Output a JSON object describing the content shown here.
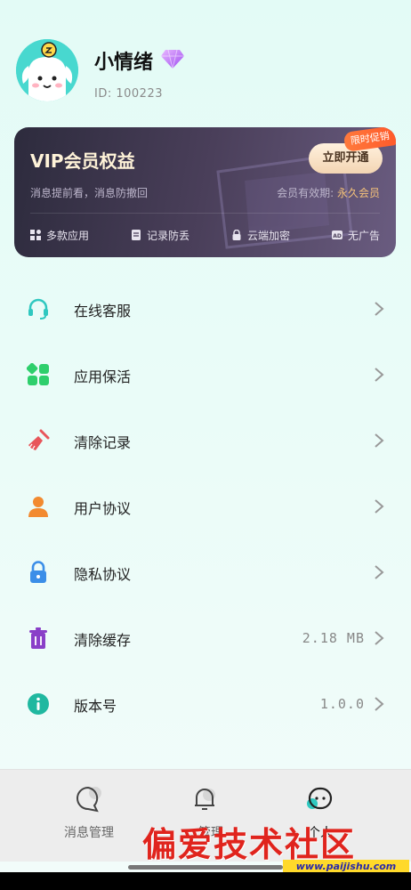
{
  "profile": {
    "username": "小情绪",
    "id_text": "ID: 100223"
  },
  "vip": {
    "title": "VIP会员权益",
    "subtitle": "消息提前看，消息防撤回",
    "expiry_label": "会员有效期:",
    "expiry_value": "永久会员",
    "button_label": "立即开通",
    "promo_tag": "限时促销",
    "features": [
      {
        "label": "多款应用",
        "icon": "apps-icon"
      },
      {
        "label": "记录防丢",
        "icon": "record-icon"
      },
      {
        "label": "云端加密",
        "icon": "lock-icon"
      },
      {
        "label": "无广告",
        "icon": "ad-icon"
      }
    ]
  },
  "menu": {
    "items": [
      {
        "label": "在线客服",
        "icon": "headset-icon",
        "value": ""
      },
      {
        "label": "应用保活",
        "icon": "apps-grid-icon",
        "value": ""
      },
      {
        "label": "清除记录",
        "icon": "broom-icon",
        "value": ""
      },
      {
        "label": "用户协议",
        "icon": "user-icon",
        "value": ""
      },
      {
        "label": "隐私协议",
        "icon": "padlock-icon",
        "value": ""
      },
      {
        "label": "清除缓存",
        "icon": "trash-icon",
        "value": "2.18 MB"
      },
      {
        "label": "版本号",
        "icon": "info-icon",
        "value": "1.0.0"
      }
    ]
  },
  "nav": {
    "items": [
      {
        "label": "消息管理",
        "icon": "chat-bubble-icon",
        "active": false
      },
      {
        "label": "…管理",
        "icon": "bell-icon",
        "active": false
      },
      {
        "label": "个人",
        "icon": "face-icon",
        "active": true
      }
    ]
  },
  "watermark": {
    "text": "偏爱技术社区",
    "url": "www.paijishu.com"
  },
  "colors": {
    "accent_teal": "#2fc8c0",
    "vip_gold": "#f5c27a",
    "promo_orange": "#ff6a30",
    "background": "#e3fbf6"
  }
}
